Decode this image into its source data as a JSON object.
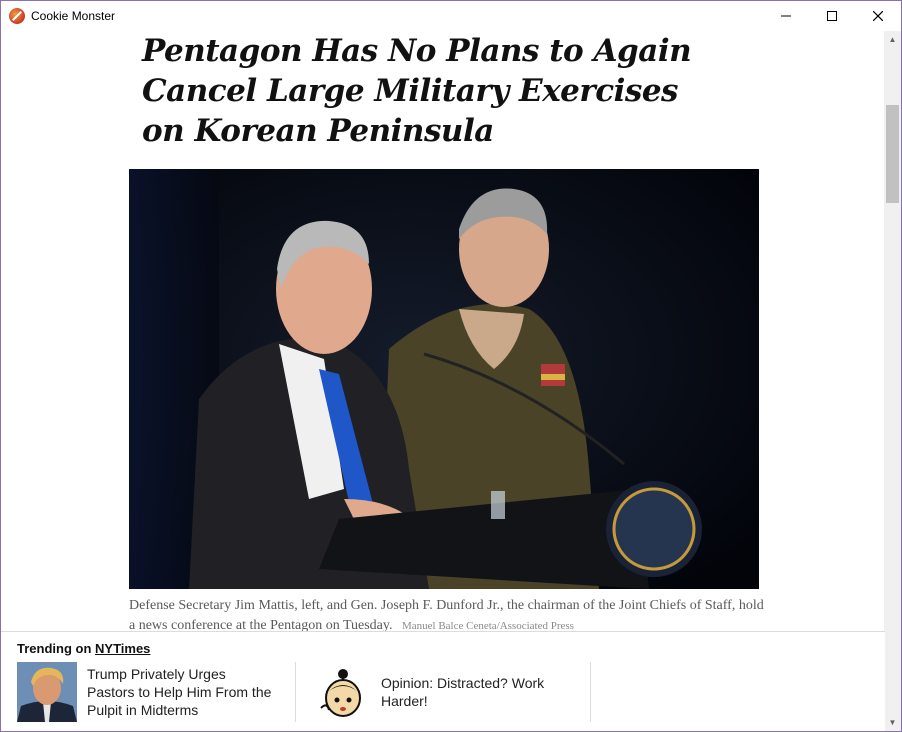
{
  "window": {
    "title": "Cookie Monster",
    "controls": {
      "minimize": "─",
      "maximize": "☐",
      "close": "✕"
    }
  },
  "article": {
    "headline": "Pentagon Has No Plans to Again Cancel Large Military Exercises on Korean Peninsula",
    "caption": "Defense Secretary Jim Mattis, left, and Gen. Joseph F. Dunford Jr., the chairman of the Joint Chiefs of Staff, hold a news conference at the Pentagon on Tuesday.",
    "credit": "Manuel Balce Ceneta/Associated Press"
  },
  "trending": {
    "label": "Trending on",
    "source": "NYTimes",
    "items": [
      {
        "title": "Trump Privately Urges Pastors to Help Him From the Pulpit in Midterms",
        "thumb": "portrait-thumbnail"
      },
      {
        "title": "Opinion: Distracted? Work Harder!",
        "thumb": "cartoon-thumbnail"
      }
    ]
  },
  "scrollbar": {
    "up": "▲",
    "down": "▼"
  },
  "colors": {
    "frame": "#8a6fb3",
    "photo_bg": "#05070b",
    "caption": "#5a5a5a"
  }
}
